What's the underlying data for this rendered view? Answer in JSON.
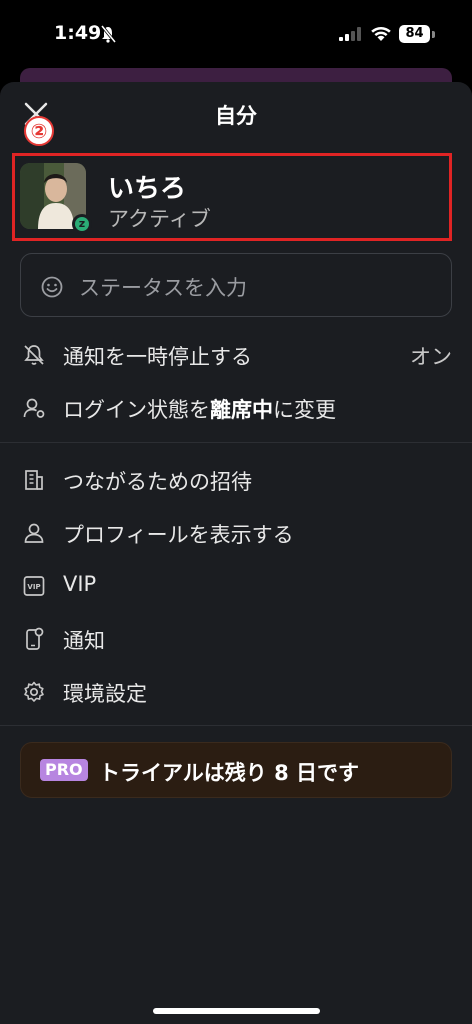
{
  "status_bar": {
    "time": "1:49",
    "battery": "84"
  },
  "header": {
    "title": "自分",
    "annotation_number": "②"
  },
  "profile": {
    "name": "いちろ",
    "status": "アクティブ",
    "presence_badge": "z"
  },
  "status_input": {
    "placeholder": "ステータスを入力"
  },
  "menu": {
    "pause_notifications": {
      "label": "通知を一時停止する",
      "value": "オン"
    },
    "login_state": {
      "prefix": "ログイン状態を",
      "emphasis": "離席中",
      "suffix": "に変更"
    },
    "items": [
      {
        "label": "つながるための招待",
        "icon": "building-icon"
      },
      {
        "label": "プロフィールを表示する",
        "icon": "person-icon"
      },
      {
        "label": "VIP",
        "icon": "vip-icon"
      },
      {
        "label": "通知",
        "icon": "phone-notification-icon"
      },
      {
        "label": "環境設定",
        "icon": "gear-icon"
      }
    ]
  },
  "trial_banner": {
    "badge": "PRO",
    "text": "トライアルは残り 8 日です"
  },
  "colors": {
    "sheet_bg": "#1b1d21",
    "highlight_border": "#e02424",
    "presence_green": "#2bac76",
    "pro_badge": "#b785e0",
    "trial_bg": "#2b1d12"
  }
}
